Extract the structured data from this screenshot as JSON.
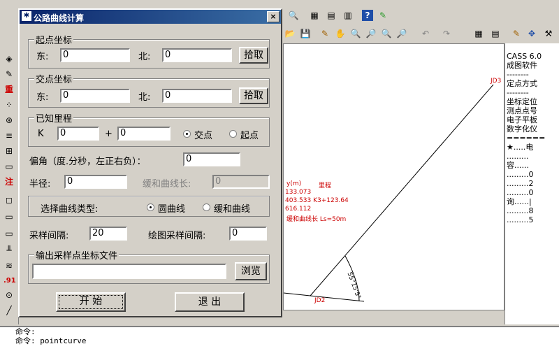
{
  "dialog": {
    "title": "公路曲线计算",
    "close_label": "×",
    "start_group": {
      "title": "起点坐标",
      "east_label": "东:",
      "east_value": "0",
      "north_label": "北:",
      "north_value": "0",
      "pick_label": "拾取"
    },
    "intersection_group": {
      "title": "交点坐标",
      "east_label": "东:",
      "east_value": "0",
      "north_label": "北:",
      "north_value": "0",
      "pick_label": "拾取"
    },
    "mileage_group": {
      "title": "已知里程",
      "k_label": "K",
      "k_value": "0",
      "plus_label": "+",
      "plus_value": "0",
      "option_intersection": "交点",
      "option_start": "起点"
    },
    "deflection_label": "偏角（度.分秒，左正右负）：",
    "deflection_value": "0",
    "radius_label": "半径:",
    "radius_value": "0",
    "transition_label": "缓和曲线长:",
    "transition_value": "0",
    "curve_type_label": "选择曲线类型:",
    "curve_option_circle": "圆曲线",
    "curve_option_transition": "缓和曲线",
    "sample_interval_label": "采样间隔:",
    "sample_interval_value": "20",
    "draw_interval_label": "绘图采样间隔:",
    "draw_interval_value": "0",
    "output_group_title": "输出采样点坐标文件",
    "output_value": "",
    "browse_label": "浏览",
    "start_button": "开 始",
    "exit_button": "退 出"
  },
  "right_panel": {
    "items": [
      "CASS 6.0",
      "成图软件",
      "--------",
      "定点方式",
      "--------",
      "坐标定位",
      "测点点号",
      "电子平板",
      "数字化仪",
      "======",
      "★.....电",
      ".........",
      "容......",
      ".........0",
      ".........2",
      ".........0",
      "询......|",
      ".........8",
      ".........5"
    ]
  },
  "drawing": {
    "label_jd3": "JD3",
    "label_jd2": "JD2",
    "text_y": "y(m)",
    "text_mileage": "里程",
    "text_1": "133.073",
    "text_2": "403.533  K3+123.64",
    "text_3": "616.112",
    "text_4": "缓和曲线长  Ls=50m",
    "angle_text": "55°15'5\""
  },
  "command": {
    "line1": "命令:",
    "line2": "命令: pointcurve"
  },
  "colors": {
    "titlebar": "#0a246a",
    "drawing_red": "#cc0000"
  }
}
